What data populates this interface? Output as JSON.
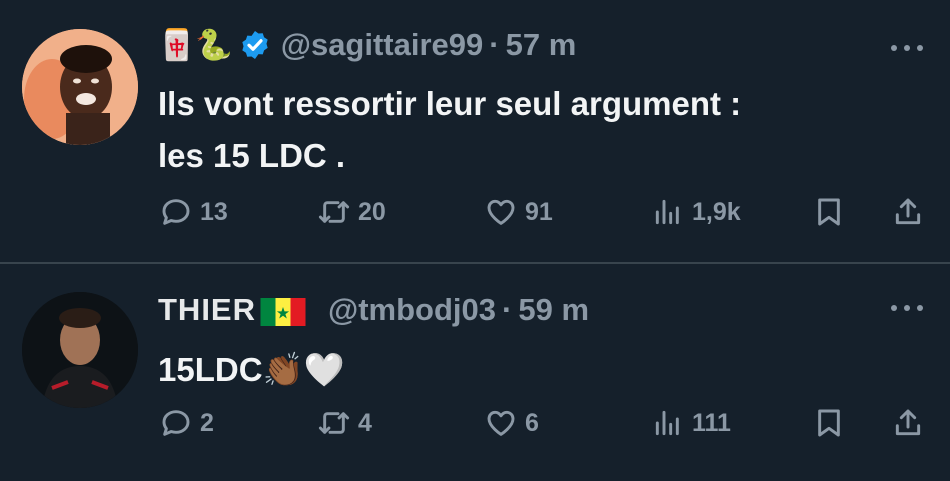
{
  "tweets": [
    {
      "name_emojis": "🀄🐍",
      "handle": "@sagittaire99",
      "separator": "·",
      "time": "57 m",
      "text_line1": "Ils vont ressortir leur seul argument :",
      "text_line2": "les 15 LDC .",
      "replies": "13",
      "reposts": "20",
      "likes": "91",
      "views": "1,9k"
    },
    {
      "name": "THIER",
      "handle": "@tmbodj03",
      "separator": "·",
      "time": "59 m",
      "text": "15LDC",
      "text_emojis": "👏🏾🤍",
      "replies": "2",
      "reposts": "4",
      "likes": "6",
      "views": "111"
    }
  ],
  "colors": {
    "background": "#15202b",
    "text": "#e7e9ea",
    "muted": "#8b98a5",
    "verified": "#1d9bf0",
    "divider": "#38444d"
  },
  "icons": [
    "reply-icon",
    "repost-icon",
    "like-icon",
    "views-icon",
    "bookmark-icon",
    "share-icon",
    "more-icon",
    "verified-icon"
  ]
}
